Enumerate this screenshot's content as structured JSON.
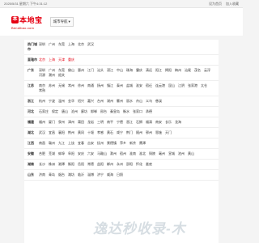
{
  "topbar": {
    "date": "2025/5/31 星期六 下午4:31:12",
    "links": [
      "设为首页",
      "加入收藏"
    ]
  },
  "logo": {
    "badge": "本",
    "name": "本地宝",
    "site": "Bendibao.com"
  },
  "nav_button": {
    "label": "城市导航",
    "arrow": "▾"
  },
  "sections": [
    {
      "label": "热门城市",
      "items": [
        "深圳",
        "广州",
        "东莞",
        "上海",
        "北京",
        "武汉"
      ]
    },
    {
      "label": "直辖市",
      "items": [
        "北京",
        "上海",
        "天津",
        "重庆"
      ],
      "red": true
    },
    {
      "label": "广东",
      "items": [
        "深圳",
        "广州",
        "东莞",
        "佛山",
        "惠州",
        "江门",
        "汕头",
        "湛江",
        "中山",
        "珠海",
        "肇庆",
        "清远",
        "阳江",
        "揭阳",
        "梅州",
        "汕尾",
        "茂名",
        "云浮",
        "河源",
        "潮州",
        "韶关"
      ]
    },
    {
      "label": "江苏",
      "items": [
        "南京",
        "苏州",
        "无锡",
        "常州",
        "徐州",
        "南通",
        "扬州",
        "镇江",
        "泰州",
        "盐城",
        "淮安",
        "宿迁",
        "连云港",
        "昆山",
        "江阴",
        "张家港",
        "太仓",
        "常熟"
      ]
    },
    {
      "label": "浙江",
      "items": [
        "杭州",
        "宁波",
        "温州",
        "金华",
        "绍兴",
        "嘉兴",
        "台州",
        "湖州",
        "衢州",
        "丽水",
        "舟山",
        "义乌",
        "慈溪"
      ]
    },
    {
      "label": "河北",
      "items": [
        "石家庄",
        "保定",
        "唐山",
        "沧州",
        "廊坊",
        "邯郸",
        "邢台",
        "秦皇岛",
        "衡水",
        "张家口",
        "承德"
      ]
    },
    {
      "label": "福建",
      "items": [
        "福州",
        "厦门",
        "泉州",
        "漳州",
        "莆田",
        "龙岩",
        "三明",
        "南平",
        "宁德",
        "晋江",
        "石狮",
        "福清",
        "南安",
        "长乐",
        "龙海"
      ]
    },
    {
      "label": "湖北",
      "items": [
        "武汉",
        "宜昌",
        "襄阳",
        "荆州",
        "黄冈",
        "十堰",
        "孝感",
        "黄石",
        "咸宁",
        "荆门",
        "随州",
        "鄂州",
        "恩施",
        "天门"
      ]
    },
    {
      "label": "江西",
      "items": [
        "南昌",
        "赣州",
        "九江",
        "上饶",
        "宜春",
        "吉安",
        "抚州",
        "景德镇",
        "萍乡",
        "新余",
        "鹰潭"
      ]
    },
    {
      "label": "安徽",
      "items": [
        "合肥",
        "芜湖",
        "蚌埠",
        "阜阳",
        "安庆",
        "六安",
        "马鞍山",
        "滁州",
        "宿州",
        "淮南",
        "淮北",
        "铜陵",
        "亳州",
        "宣城",
        "池州",
        "黄山"
      ]
    },
    {
      "label": "湖南",
      "items": [
        "长沙",
        "株洲",
        "湘潭",
        "衡阳",
        "岳阳",
        "常德",
        "益阳",
        "郴州",
        "永州",
        "邵阳",
        "怀化",
        "娄底"
      ]
    },
    {
      "label": "山东",
      "items": [
        "济南",
        "青岛",
        "烟台",
        "潍坊",
        "临沂",
        "淄博",
        "济宁",
        "威海",
        "日照"
      ]
    }
  ],
  "watermark": "逸达秒收录-木"
}
